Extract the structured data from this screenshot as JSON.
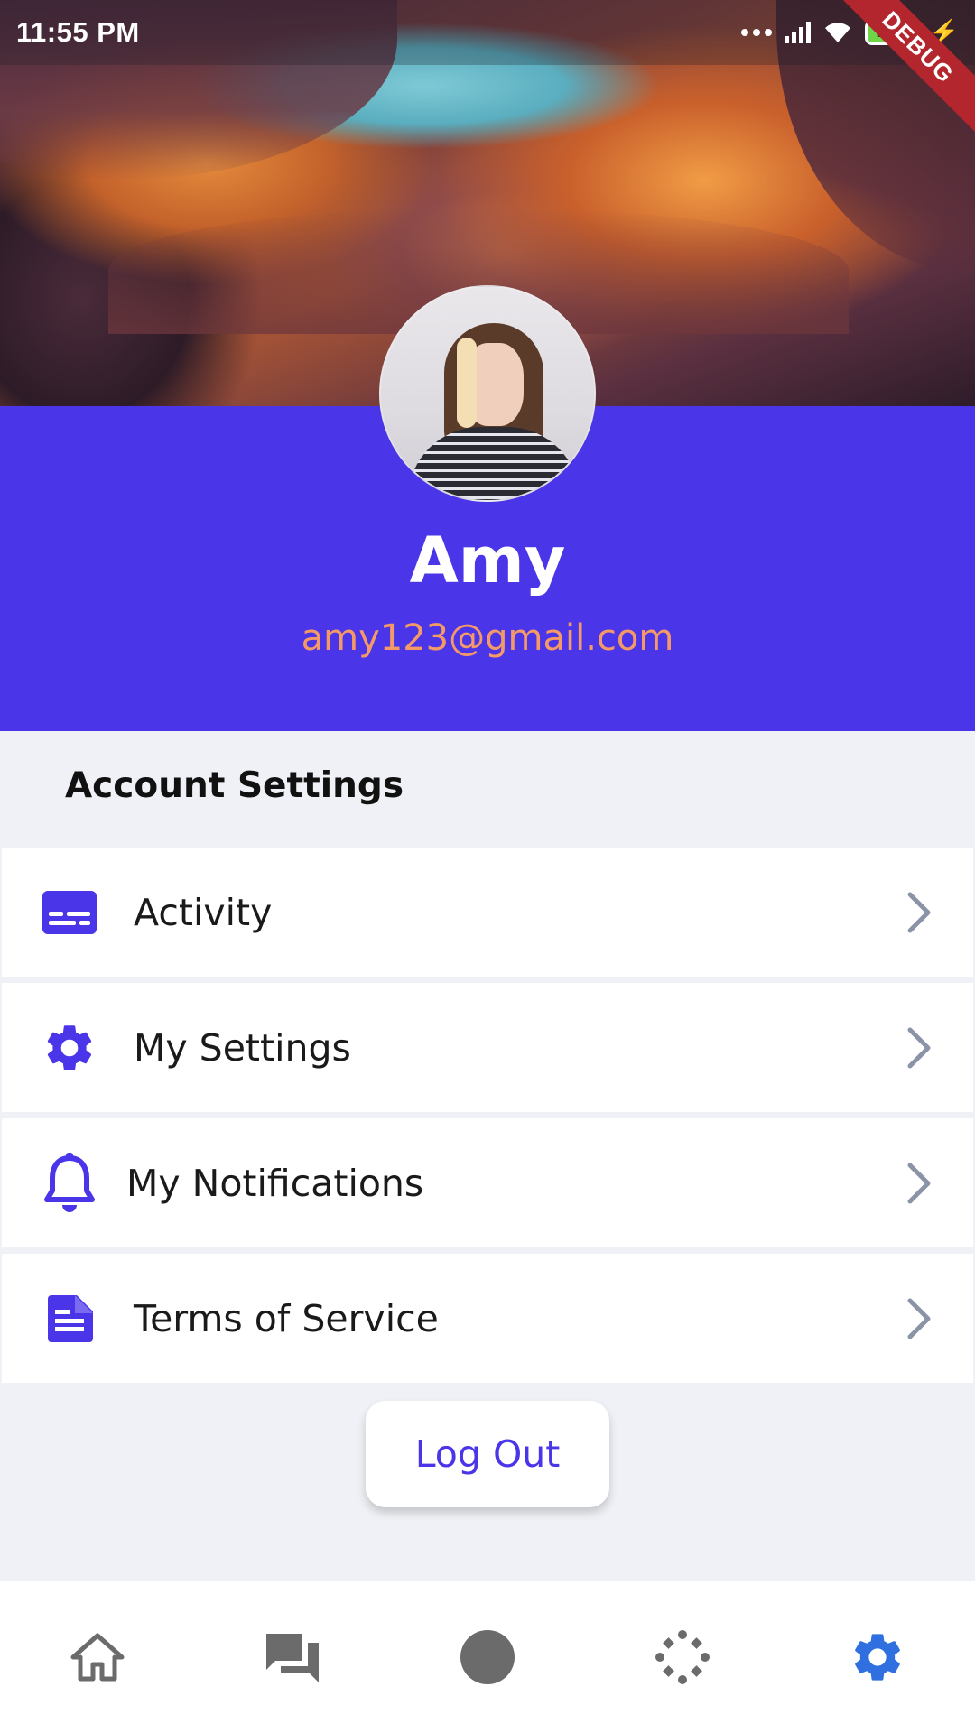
{
  "status_bar": {
    "time": "11:55 PM",
    "battery": "100",
    "debug_banner": "DEBUG"
  },
  "profile": {
    "name": "Amy",
    "email": "amy123@gmail.com"
  },
  "account_settings": {
    "title": "Account Settings",
    "items": [
      {
        "label": "Activity",
        "icon": "subtitles-icon"
      },
      {
        "label": "My Settings",
        "icon": "gear-icon"
      },
      {
        "label": "My Notifications",
        "icon": "bell-icon"
      },
      {
        "label": "Terms of Service",
        "icon": "document-icon"
      }
    ]
  },
  "logout_label": "Log Out",
  "bottom_nav": {
    "items": [
      "home-icon",
      "chat-icon",
      "circle-icon",
      "loader-icon",
      "gear-icon"
    ],
    "active": "gear-icon"
  },
  "colors": {
    "primary": "#4a35e8",
    "email_accent": "#f59a67",
    "chevron": "#8a94a6",
    "nav_inactive": "#6b6b6b",
    "nav_active": "#2f6fe0"
  }
}
